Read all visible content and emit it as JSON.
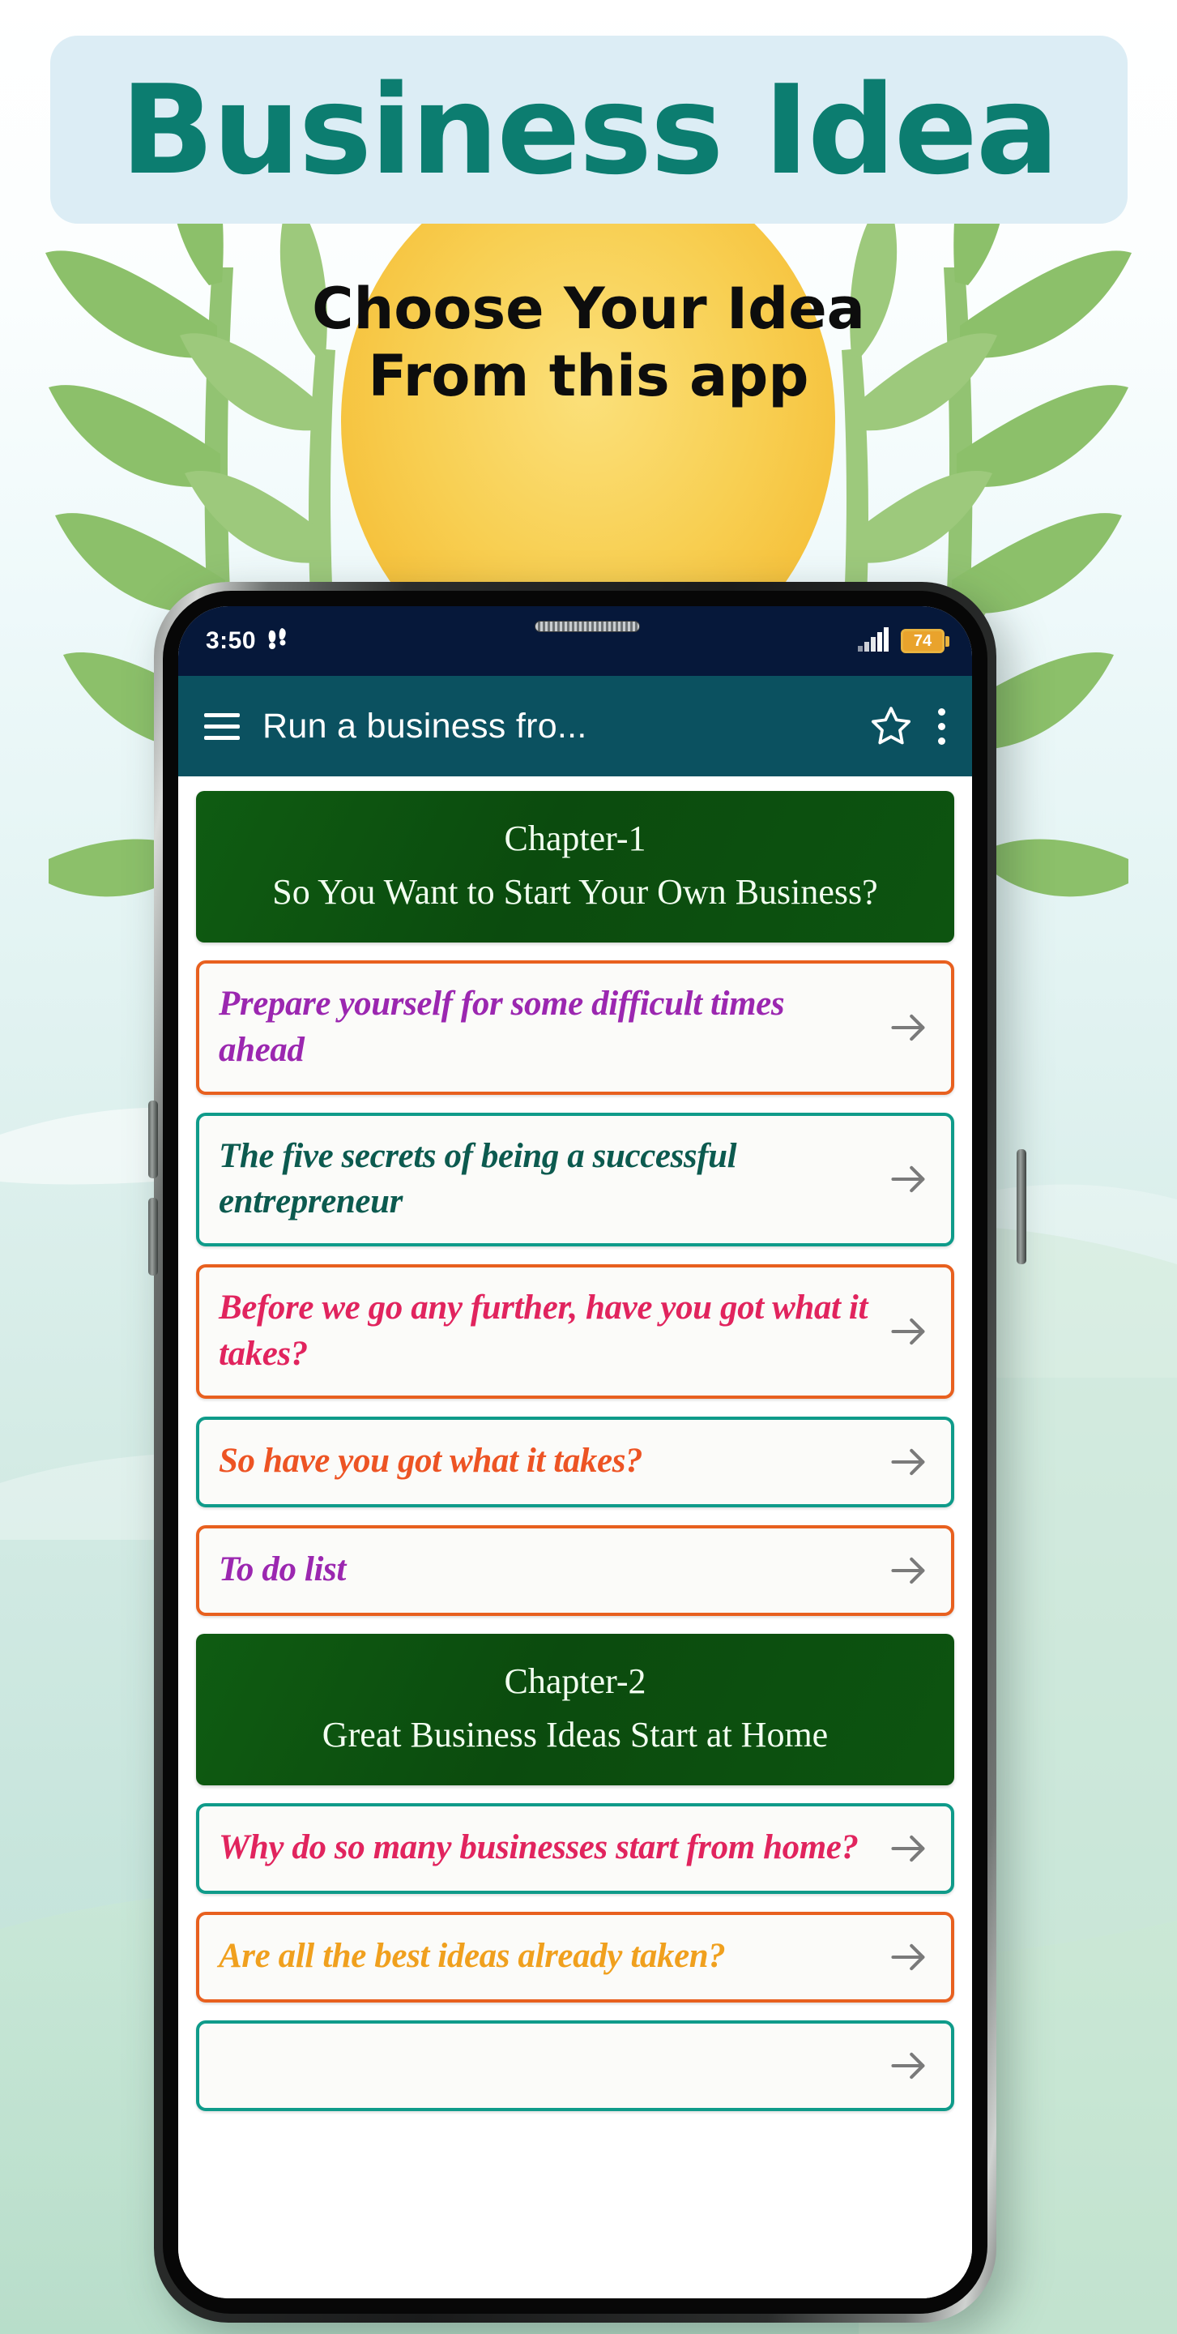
{
  "promo": {
    "title": "Business Idea",
    "subtitle_line1": "Choose Your Idea",
    "subtitle_line2": "From this app",
    "title_color": "#0c7d70",
    "title_plate_color": "#dcedf5",
    "background_top_color": "#ffffff",
    "background_bottom_color": "#bfe0d6",
    "sun_color": "#f7c33f",
    "leaf_color": "#8cc06a"
  },
  "phone": {
    "status_bar": {
      "time": "3:50",
      "footsteps_icon": "footsteps-icon",
      "signal_icon": "signal-bars-icon",
      "battery_level": "74",
      "background_color": "#06183a"
    },
    "app_bar": {
      "menu_icon": "hamburger-menu-icon",
      "title": "Run a business fro...",
      "star_icon": "star-outline-icon",
      "overflow_icon": "more-vertical-icon",
      "background_color": "#0b5160"
    },
    "content": {
      "items": [
        {
          "kind": "chapter",
          "number": "Chapter-1",
          "title": "So You Want to Start Your Own Business?"
        },
        {
          "kind": "card",
          "text": "Prepare yourself for some difficult times ahead",
          "text_color": "#9b27b0",
          "border_color": "#e8601f"
        },
        {
          "kind": "card",
          "text": "The five secrets of being a successful entrepreneur",
          "text_color": "#0c5a4f",
          "border_color": "#0f9b8a"
        },
        {
          "kind": "card",
          "text": "Before we go any further, have you got what it takes?",
          "text_color": "#e1245e",
          "border_color": "#e8601f"
        },
        {
          "kind": "card",
          "text": "So have you got what it takes?",
          "text_color": "#ed5424",
          "border_color": "#0f9b8a"
        },
        {
          "kind": "card",
          "text": "To do list",
          "text_color": "#9b27b0",
          "border_color": "#e8601f"
        },
        {
          "kind": "chapter",
          "number": "Chapter-2",
          "title": "Great Business Ideas Start at Home"
        },
        {
          "kind": "card",
          "text": "Why do so many businesses start from home?",
          "text_color": "#e1245e",
          "border_color": "#0f9b8a"
        },
        {
          "kind": "card",
          "text": "Are all the best ideas already taken?",
          "text_color": "#f0a01e",
          "border_color": "#e8601f"
        },
        {
          "kind": "card",
          "text": "",
          "text_color": "#0c5a4f",
          "border_color": "#0f9b8a"
        }
      ],
      "arrow_icon": "arrow-right-icon"
    }
  }
}
